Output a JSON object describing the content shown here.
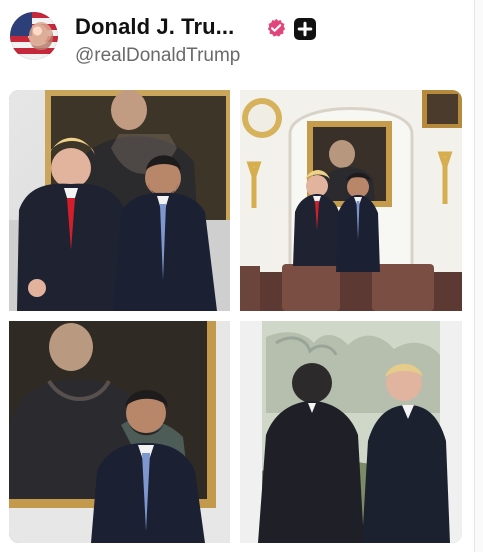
{
  "post": {
    "author": {
      "display_name": "Donald J. Tru...",
      "handle": "@realDonaldTrump",
      "avatar_icon": "profile-avatar",
      "badges": [
        "verified-badge-icon",
        "plus-badge-icon"
      ]
    },
    "media": {
      "count": 4,
      "items": [
        {
          "icon": "photo-trump-and-man-with-portrait"
        },
        {
          "icon": "photo-trump-and-man-formal-room"
        },
        {
          "icon": "photo-man-before-portrait"
        },
        {
          "icon": "photo-two-men-window-view"
        }
      ]
    }
  },
  "colors": {
    "verified": "#e0457b",
    "plus_badge_bg": "#111111",
    "display_name": "#111111",
    "handle": "#6a6a6a"
  }
}
